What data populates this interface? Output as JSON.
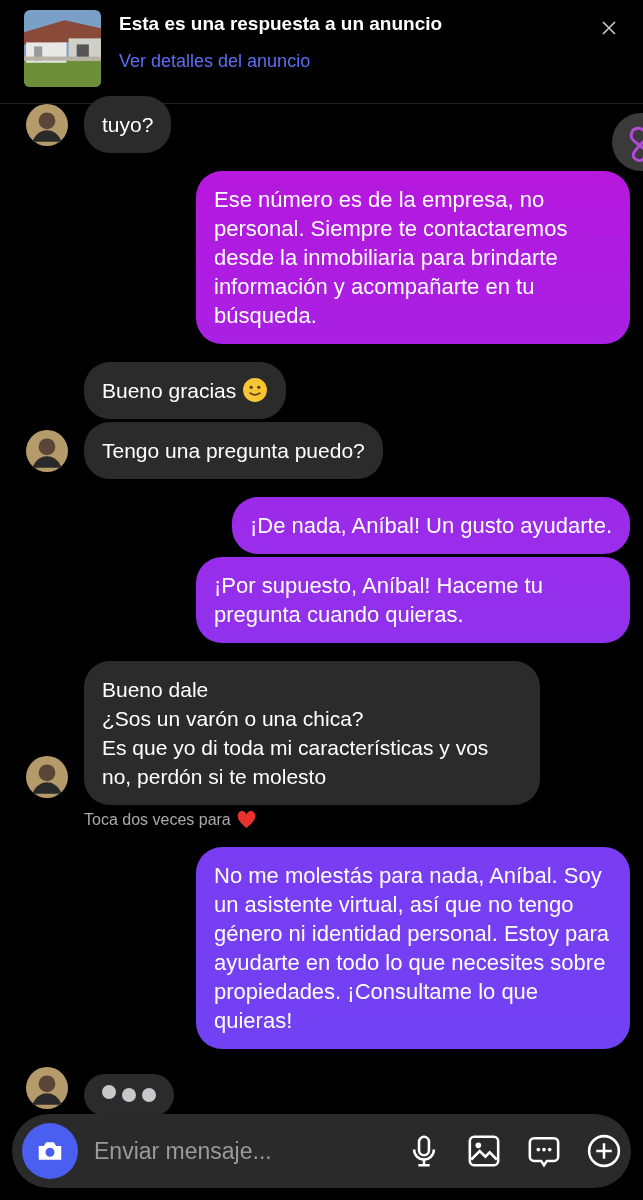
{
  "ad_banner": {
    "title": "Esta es una respuesta a un anuncio",
    "link": "Ver detalles del anuncio"
  },
  "messages": [
    {
      "kind": "incoming",
      "text": "tuyo?",
      "avatar": true,
      "smiley": false
    },
    {
      "kind": "outgoing",
      "text": "Ese número es de la empresa, no personal. Siempre te contactaremos desde la inmobiliaria para brindarte información y acompañarte en tu búsqueda."
    },
    {
      "kind": "incoming",
      "text": "Bueno gracias",
      "avatar": false,
      "smiley": true
    },
    {
      "kind": "incoming",
      "text": "Tengo una pregunta puedo?",
      "avatar": true,
      "smiley": false
    },
    {
      "kind": "outgoing",
      "text": "¡De nada, Aníbal! Un gusto ayudarte."
    },
    {
      "kind": "outgoing",
      "text": "¡Por supuesto, Aníbal! Haceme tu pregunta cuando quieras."
    },
    {
      "kind": "incoming",
      "text": "Bueno dale\n¿Sos un varón o una chica?\nEs que yo di toda mi características y vos no, perdón si te molesto",
      "avatar": true,
      "smiley": false,
      "hint": "Toca dos veces para"
    },
    {
      "kind": "outgoing",
      "text": "No me molestás para nada, Aníbal. Soy un asistente virtual, así que no tengo género ni identidad personal. Estoy para ayudarte en todo lo que necesites sobre propiedades. ¡Consultame lo que quieras!"
    },
    {
      "kind": "typing",
      "avatar": true
    }
  ],
  "composer": {
    "placeholder": "Enviar mensaje..."
  }
}
